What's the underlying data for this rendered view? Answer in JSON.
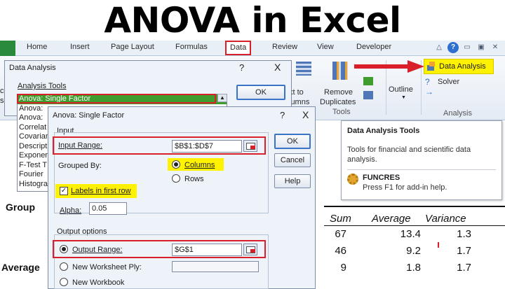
{
  "banner": {
    "title": "ANOVA in Excel"
  },
  "ribbon": {
    "tabs": [
      "Home",
      "Insert",
      "Page Layout",
      "Formulas",
      "Data",
      "Review",
      "View",
      "Developer"
    ],
    "right_icons": [
      "minimize-ribbon-icon",
      "help-icon",
      "window-min-icon",
      "window-restore-icon",
      "window-close-icon"
    ],
    "text_to_columns": [
      "xt to",
      "lumns"
    ],
    "remove_dup": [
      "Remove",
      "Duplicates"
    ],
    "tools_group": "Tools",
    "outline": "Outline",
    "data_analysis": "Data Analysis",
    "solver": "Solver",
    "analysis_group": "Analysis",
    "help_glyph": "?"
  },
  "tooltip": {
    "title": "Data Analysis Tools",
    "desc": "Tools for financial and scientific data analysis.",
    "addin_name": "FUNCRES",
    "addin_help": "Press F1 for add-in help."
  },
  "sheet": {
    "group_label": "Group",
    "average_label": "Average",
    "col_sum": "Sum",
    "col_average": "Average",
    "col_variance": "Variance",
    "rows": [
      {
        "sum": "67",
        "average": "13.4",
        "variance": "1.3"
      },
      {
        "sum": "46",
        "average": "9.2",
        "variance": "1.7"
      },
      {
        "sum": "9",
        "average": "1.8",
        "variance": "1.7"
      }
    ],
    "edge_text": [
      "ce",
      "s"
    ]
  },
  "data_analysis_dialog": {
    "title": "Data Analysis",
    "q": "?",
    "x": "X",
    "analysis_tools_label": "Analysis Tools",
    "items": [
      "Anova: Single Factor",
      "Anova:",
      "Anova:",
      "Correlat",
      "Covarian",
      "Descript",
      "Exponen",
      "F-Test T",
      "Fourier",
      "Histogra"
    ],
    "ok": "OK"
  },
  "anova_dialog": {
    "title": "Anova: Single Factor",
    "q": "?",
    "x": "X",
    "input_label": "Input",
    "input_range_label": "Input Range:",
    "input_range_value": "$B$1:$D$7",
    "grouped_by_label": "Grouped By:",
    "columns": "Columns",
    "rows": "Rows",
    "labels_first_row": "Labels in first row",
    "alpha_label": "Alpha:",
    "alpha_value": "0.05",
    "output_options_label": "Output options",
    "output_range_label": "Output Range:",
    "output_range_value": "$G$1",
    "new_worksheet": "New Worksheet Ply:",
    "new_workbook": "New Workbook",
    "ok": "OK",
    "cancel": "Cancel",
    "help": "Help"
  },
  "colors": {
    "highlight_red": "#d9202a",
    "highlight_yellow": "#fff200",
    "selected_green": "#3f9d2d"
  }
}
